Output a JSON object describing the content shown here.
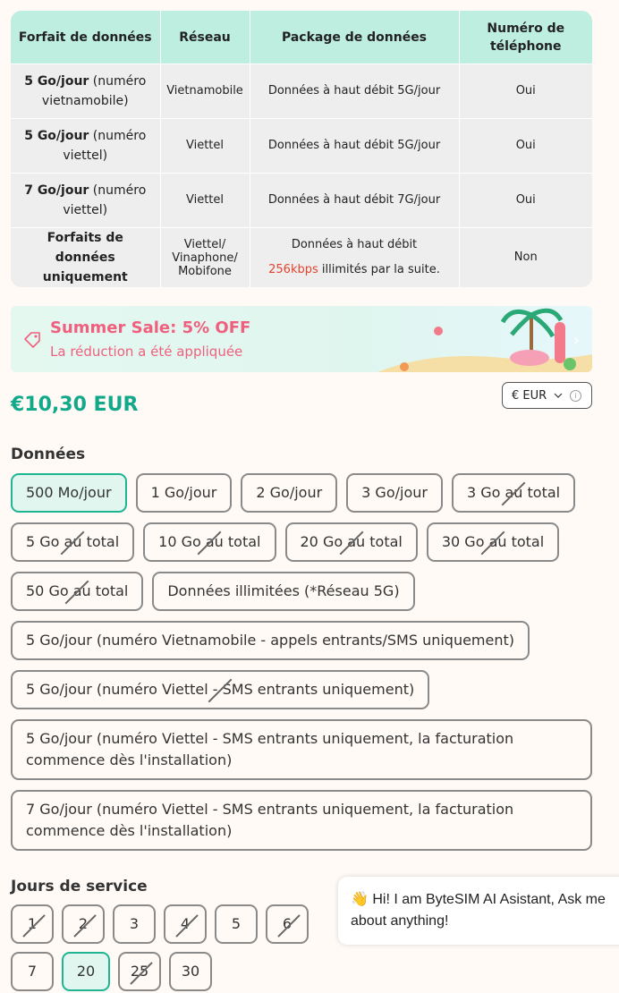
{
  "table": {
    "headers": [
      "Forfait de données",
      "Réseau",
      "Package de données",
      "Numéro de téléphone"
    ],
    "rows": [
      {
        "plan_bold": "5 Go/jour",
        "plan_rest": " (numéro vietnamobile)",
        "network": "Vietnamobile",
        "package": "Données  à haut débit 5G/jour",
        "phone": "Oui"
      },
      {
        "plan_bold": "5 Go/jour",
        "plan_rest": " (numéro viettel)",
        "network": "Viettel",
        "package": "Données à haut débit 5G/jour",
        "phone": "Oui"
      },
      {
        "plan_bold": "7 Go/jour",
        "plan_rest": " (numéro viettel)",
        "network": "Viettel",
        "package": "Données à haut débit 7G/jour",
        "phone": "Oui"
      },
      {
        "plan_bold": "Forfaits de données uniquement",
        "plan_rest": "",
        "network": "Viettel/ Vinaphone/ Mobifone",
        "package_line1": "Données à haut débit",
        "package_red": "256kbps",
        "package_line2": " illimités par la suite.",
        "phone": "Non"
      }
    ]
  },
  "banner": {
    "title": "Summer Sale: 5% OFF",
    "subtitle": "La réduction a été appliquée",
    "icon": "tag-icon",
    "accent": "#f0607e"
  },
  "price": {
    "value": "€10,30 EUR",
    "color": "#11a98a"
  },
  "currency": {
    "label": "€ EUR",
    "icon": "chevron-down-icon"
  },
  "data_section": {
    "title": "Données",
    "options": [
      {
        "label": "500 Mo/jour",
        "selected": true,
        "disabled": false
      },
      {
        "label": "1 Go/jour",
        "selected": false,
        "disabled": false
      },
      {
        "label": "2 Go/jour",
        "selected": false,
        "disabled": false
      },
      {
        "label": "3 Go/jour",
        "selected": false,
        "disabled": false
      },
      {
        "label": "3 Go au total",
        "selected": false,
        "disabled": true
      },
      {
        "label": "5 Go au total",
        "selected": false,
        "disabled": true
      },
      {
        "label": "10 Go au total",
        "selected": false,
        "disabled": true
      },
      {
        "label": "20 Go au total",
        "selected": false,
        "disabled": true
      },
      {
        "label": "30 Go au total",
        "selected": false,
        "disabled": true
      },
      {
        "label": "50 Go au total",
        "selected": false,
        "disabled": true
      },
      {
        "label": "Données illimitées (*Réseau 5G)",
        "selected": false,
        "disabled": false
      },
      {
        "label": "5 Go/jour (numéro Vietnamobile - appels entrants/SMS uniquement)",
        "selected": false,
        "disabled": false
      },
      {
        "label": "5 Go/jour (numéro Viettel - SMS entrants uniquement)",
        "selected": false,
        "disabled": true
      },
      {
        "label": "5 Go/jour (numéro Viettel - SMS entrants uniquement, la facturation commence dès l'installation)",
        "selected": false,
        "disabled": false,
        "wide": true
      },
      {
        "label": "7 Go/jour (numéro Viettel - SMS entrants uniquement, la facturation commence dès l'installation)",
        "selected": false,
        "disabled": false,
        "wide": true
      }
    ]
  },
  "days_section": {
    "title": "Jours de service",
    "options": [
      {
        "label": "1",
        "selected": false,
        "disabled": true
      },
      {
        "label": "2",
        "selected": false,
        "disabled": true
      },
      {
        "label": "3",
        "selected": false,
        "disabled": false
      },
      {
        "label": "4",
        "selected": false,
        "disabled": true
      },
      {
        "label": "5",
        "selected": false,
        "disabled": false
      },
      {
        "label": "6",
        "selected": false,
        "disabled": true
      },
      {
        "label": "7",
        "selected": false,
        "disabled": false
      },
      {
        "label": "20",
        "selected": true,
        "disabled": false
      },
      {
        "label": "25",
        "selected": false,
        "disabled": true
      },
      {
        "label": "30",
        "selected": false,
        "disabled": false
      }
    ]
  },
  "chat": {
    "emoji": "👋",
    "text": "Hi! I am ByteSIM AI Asistant, Ask me about anything!"
  }
}
